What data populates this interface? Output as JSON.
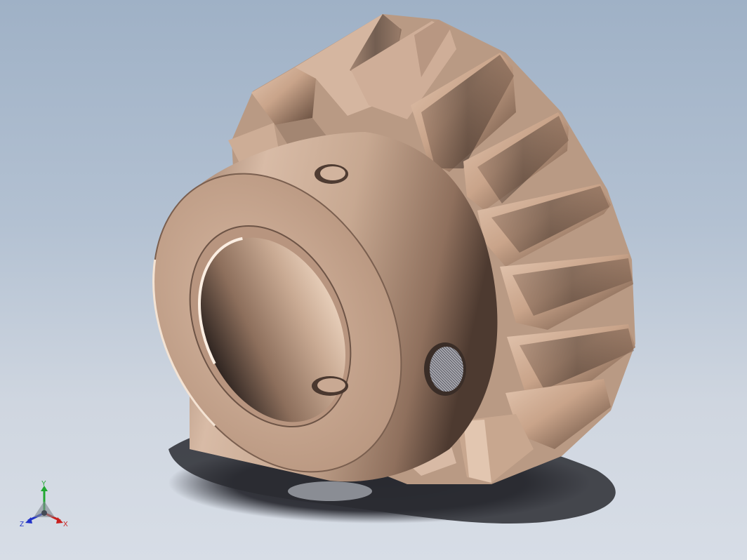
{
  "viewport": {
    "background_top": "#9fb1c6",
    "background_bottom": "#d7dde6",
    "model_color": "#d2b299",
    "shadow_color": "#2b2c33"
  },
  "triad": {
    "x_label": "X",
    "y_label": "Y",
    "z_label": "Z",
    "x_color": "#c8201e",
    "y_color": "#22a832",
    "z_color": "#2233c8"
  }
}
